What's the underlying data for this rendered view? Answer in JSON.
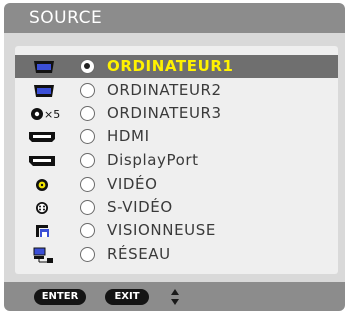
{
  "window": {
    "title": "SOURCE"
  },
  "sources": [
    {
      "label": "ORDINATEUR1",
      "icon": "computer-icon",
      "selected": true
    },
    {
      "label": "ORDINATEUR2",
      "icon": "computer-icon",
      "selected": false
    },
    {
      "label": "ORDINATEUR3",
      "icon": "rgbhv-x5-icon",
      "icon_text": "×5",
      "selected": false
    },
    {
      "label": "HDMI",
      "icon": "hdmi-icon",
      "selected": false
    },
    {
      "label": "DisplayPort",
      "icon": "displayport-icon",
      "selected": false
    },
    {
      "label": "VIDÉO",
      "icon": "video-rca-icon",
      "selected": false
    },
    {
      "label": "S-VIDÉO",
      "icon": "s-video-icon",
      "selected": false
    },
    {
      "label": "VISIONNEUSE",
      "icon": "viewer-icon",
      "selected": false
    },
    {
      "label": "RÉSEAU",
      "icon": "network-icon",
      "selected": false
    }
  ],
  "footer": {
    "enter_label": "ENTER",
    "exit_label": "EXIT",
    "nav_icon": "up-down-arrows-icon"
  },
  "colors": {
    "title_bar": "#8c8c8c",
    "panel": "#d9d9d9",
    "list_bg": "#efefef",
    "selected_row": "#6f6f6f",
    "selected_text": "#fff200",
    "text": "#3a3a3a"
  }
}
